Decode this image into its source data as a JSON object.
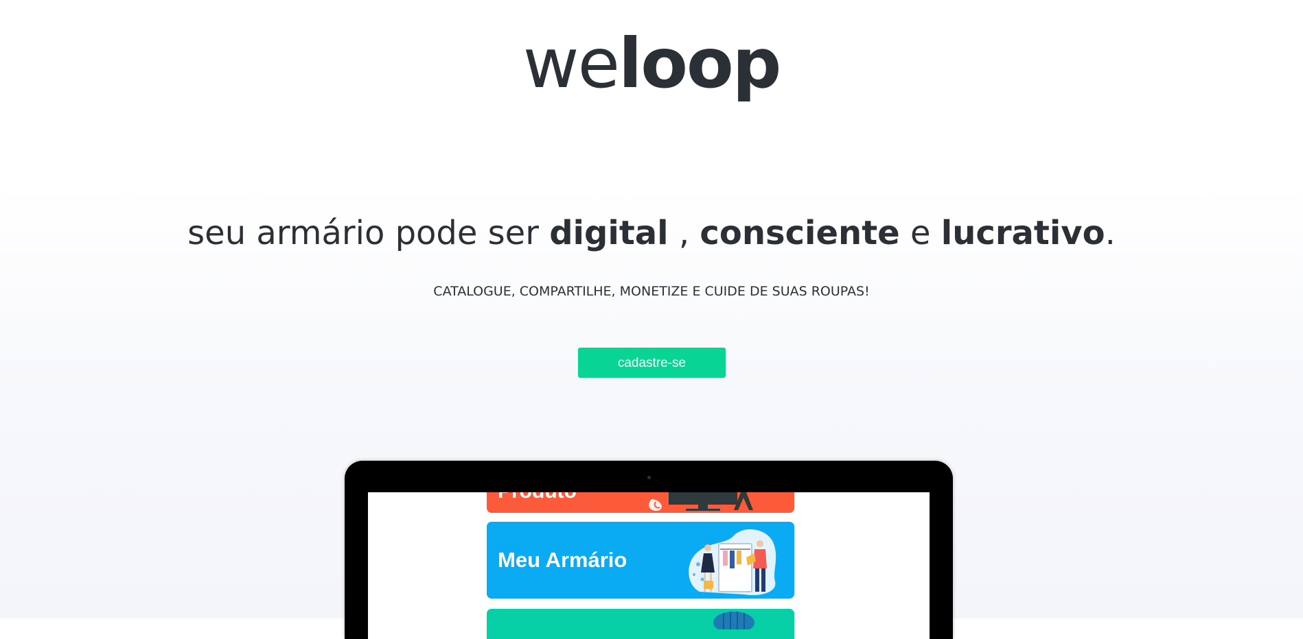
{
  "logo": {
    "part_light": "we",
    "part_bold": "loop"
  },
  "hero": {
    "headline": {
      "t1": "seu armário pode ser ",
      "b1": "digital",
      "t2": " , ",
      "b2": "consciente",
      "t3": " e ",
      "b3": "lucrativo",
      "t4": "."
    },
    "subline": "CATALOGUE, COMPARTILHE, MONETIZE E CUIDE DE SUAS ROUPAS!",
    "cta_label": "cadastre-se"
  },
  "mockup": {
    "cards": [
      {
        "label": "Produto",
        "color": "#fb5a3b"
      },
      {
        "label": "Meu Armário",
        "color": "#0aabf2"
      },
      {
        "label": "",
        "color": "#07cfa6"
      }
    ]
  },
  "colors": {
    "accent": "#08d494",
    "text": "#2b2f36"
  }
}
